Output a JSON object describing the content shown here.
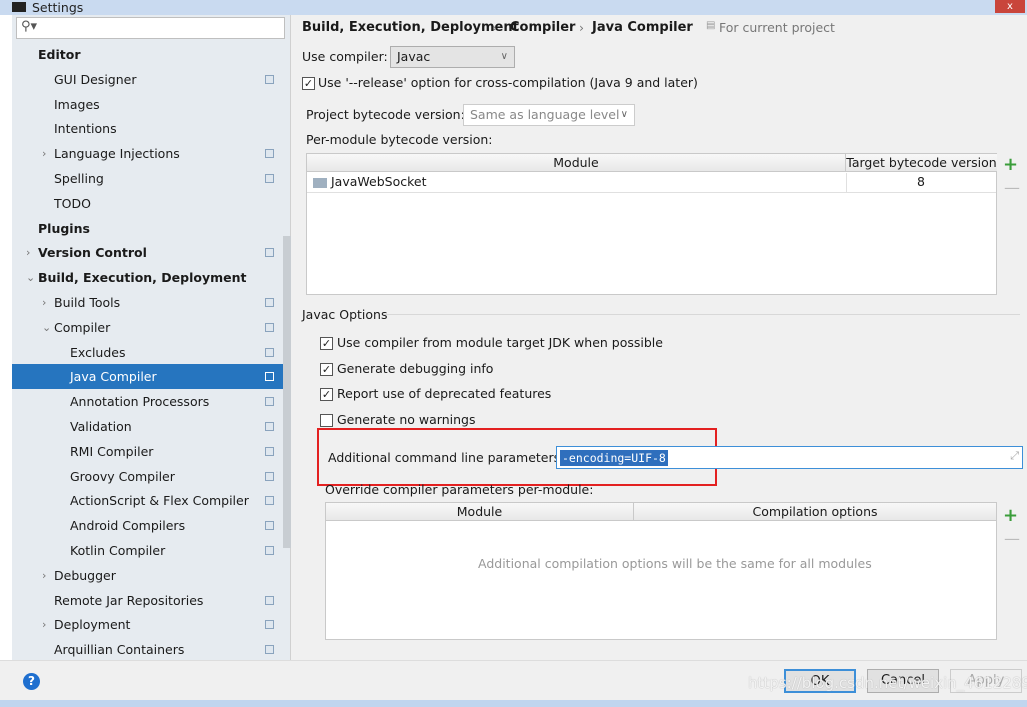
{
  "window": {
    "title": "Settings",
    "close": "x"
  },
  "sidebar": {
    "search_icon": "search-icon",
    "items": [
      {
        "label": "Editor",
        "level": 0,
        "bold": true,
        "arrow": false,
        "proj": false
      },
      {
        "label": "GUI Designer",
        "level": 1,
        "arrow": false,
        "proj": true
      },
      {
        "label": "Images",
        "level": 1,
        "arrow": false,
        "proj": false
      },
      {
        "label": "Intentions",
        "level": 1,
        "arrow": false,
        "proj": false
      },
      {
        "label": "Language Injections",
        "level": 1,
        "arrow": "right",
        "proj": true
      },
      {
        "label": "Spelling",
        "level": 1,
        "arrow": false,
        "proj": true
      },
      {
        "label": "TODO",
        "level": 1,
        "arrow": false,
        "proj": false
      },
      {
        "label": "Plugins",
        "level": 0,
        "bold": true,
        "arrow": false,
        "proj": false
      },
      {
        "label": "Version Control",
        "level": 0,
        "bold": true,
        "arrow": "right",
        "proj": true
      },
      {
        "label": "Build, Execution, Deployment",
        "level": 0,
        "bold": true,
        "arrow": "down",
        "proj": false
      },
      {
        "label": "Build Tools",
        "level": 1,
        "arrow": "right",
        "proj": true
      },
      {
        "label": "Compiler",
        "level": 1,
        "arrow": "down",
        "proj": true
      },
      {
        "label": "Excludes",
        "level": 2,
        "arrow": false,
        "proj": true
      },
      {
        "label": "Java Compiler",
        "level": 2,
        "arrow": false,
        "proj": true,
        "selected": true
      },
      {
        "label": "Annotation Processors",
        "level": 2,
        "arrow": false,
        "proj": true
      },
      {
        "label": "Validation",
        "level": 2,
        "arrow": false,
        "proj": true
      },
      {
        "label": "RMI Compiler",
        "level": 2,
        "arrow": false,
        "proj": true
      },
      {
        "label": "Groovy Compiler",
        "level": 2,
        "arrow": false,
        "proj": true
      },
      {
        "label": "ActionScript & Flex Compiler",
        "level": 2,
        "arrow": false,
        "proj": true
      },
      {
        "label": "Android Compilers",
        "level": 2,
        "arrow": false,
        "proj": true
      },
      {
        "label": "Kotlin Compiler",
        "level": 2,
        "arrow": false,
        "proj": true
      },
      {
        "label": "Debugger",
        "level": 1,
        "arrow": "right",
        "proj": false
      },
      {
        "label": "Remote Jar Repositories",
        "level": 1,
        "arrow": false,
        "proj": true
      },
      {
        "label": "Deployment",
        "level": 1,
        "arrow": "right",
        "proj": true
      },
      {
        "label": "Arquillian Containers",
        "level": 1,
        "arrow": false,
        "proj": true
      }
    ]
  },
  "breadcrumb": {
    "a": "Build, Execution, Deployment",
    "b": "Compiler",
    "c": "Java Compiler",
    "sep": "›",
    "scope": "For current project"
  },
  "compiler": {
    "label": "Use compiler:",
    "value": "Javac"
  },
  "release": {
    "label": "Use '--release' option for cross-compilation (Java 9 and later)",
    "checked": true
  },
  "bytecode": {
    "label": "Project bytecode version:",
    "value": "Same as language level",
    "per_module": "Per-module bytecode version:"
  },
  "module_table": {
    "headers": [
      "Module",
      "Target bytecode version"
    ],
    "rows": [
      {
        "module": "JavaWebSocket",
        "version": "8"
      }
    ]
  },
  "javac": {
    "section": "Javac Options",
    "options": [
      {
        "label": "Use compiler from module target JDK when possible",
        "checked": true
      },
      {
        "label": "Generate debugging info",
        "checked": true
      },
      {
        "label": "Report use of deprecated features",
        "checked": true
      },
      {
        "label": "Generate no warnings",
        "checked": false
      }
    ],
    "params_label": "Additional command line parameters:",
    "params_value": "-encoding=UIF-8",
    "override_label": "Override compiler parameters per-module:"
  },
  "override_table": {
    "headers": [
      "Module",
      "Compilation options"
    ],
    "empty": "Additional compilation options will be the same for all modules"
  },
  "buttons": {
    "ok": "OK",
    "cancel": "Cancel",
    "apply": "Apply",
    "help": "?"
  },
  "watermark": "https://blog.csdn.net/weixin_46122892"
}
